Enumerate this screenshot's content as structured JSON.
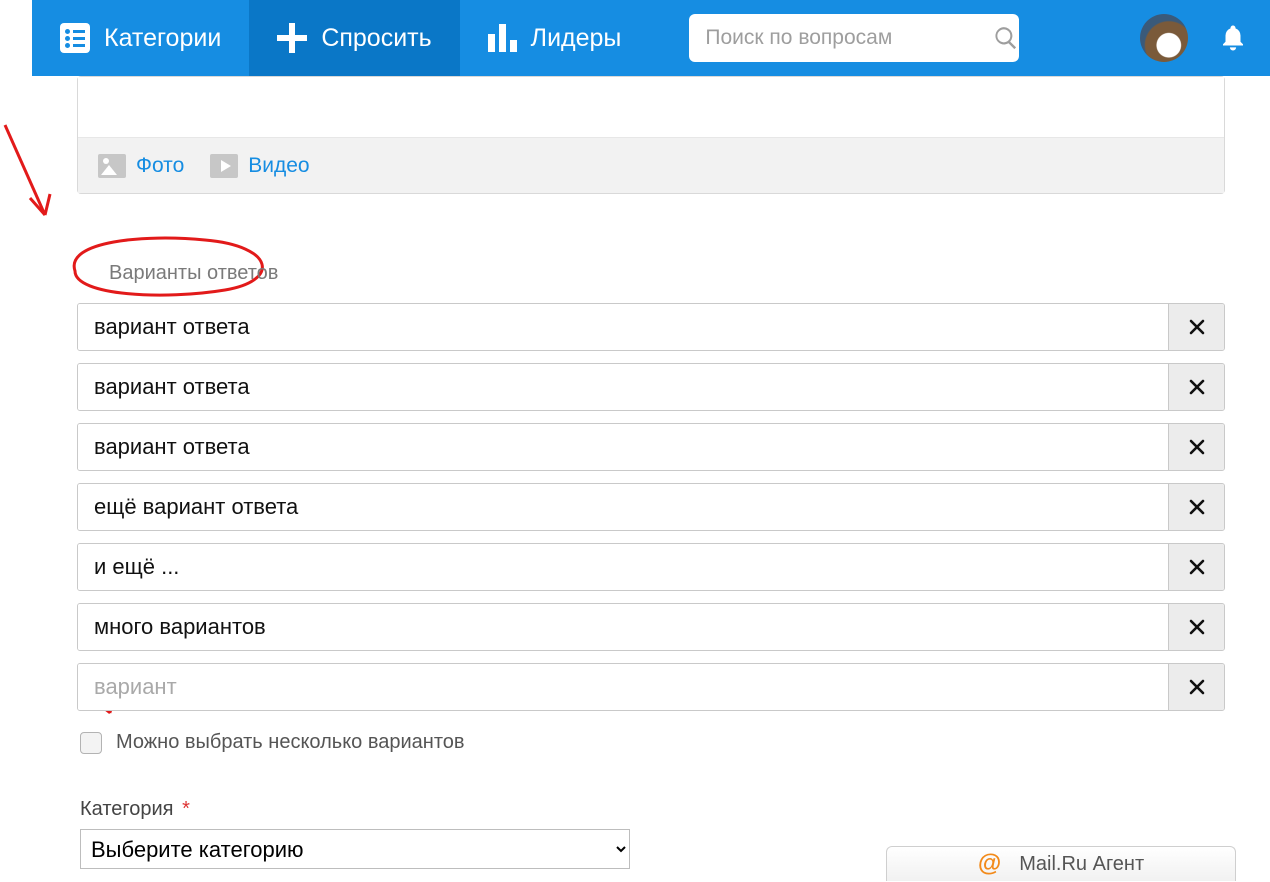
{
  "nav": {
    "categories": "Категории",
    "ask": "Спросить",
    "leaders": "Лидеры",
    "search_placeholder": "Поиск по вопросам"
  },
  "media": {
    "photo": "Фото",
    "video": "Видео"
  },
  "answers_section_label": "Варианты ответов",
  "options": [
    "вариант ответа",
    "вариант ответа",
    "вариант ответа",
    "ещё вариант ответа",
    "и ещё ...",
    "много вариантов"
  ],
  "option_placeholder": "вариант",
  "multi_select_label": "Можно выбрать несколько вариантов",
  "category_label": "Категория",
  "required_mark": "*",
  "category_select_placeholder": "Выберите категорию",
  "agent_label": "Mail.Ru Агент"
}
